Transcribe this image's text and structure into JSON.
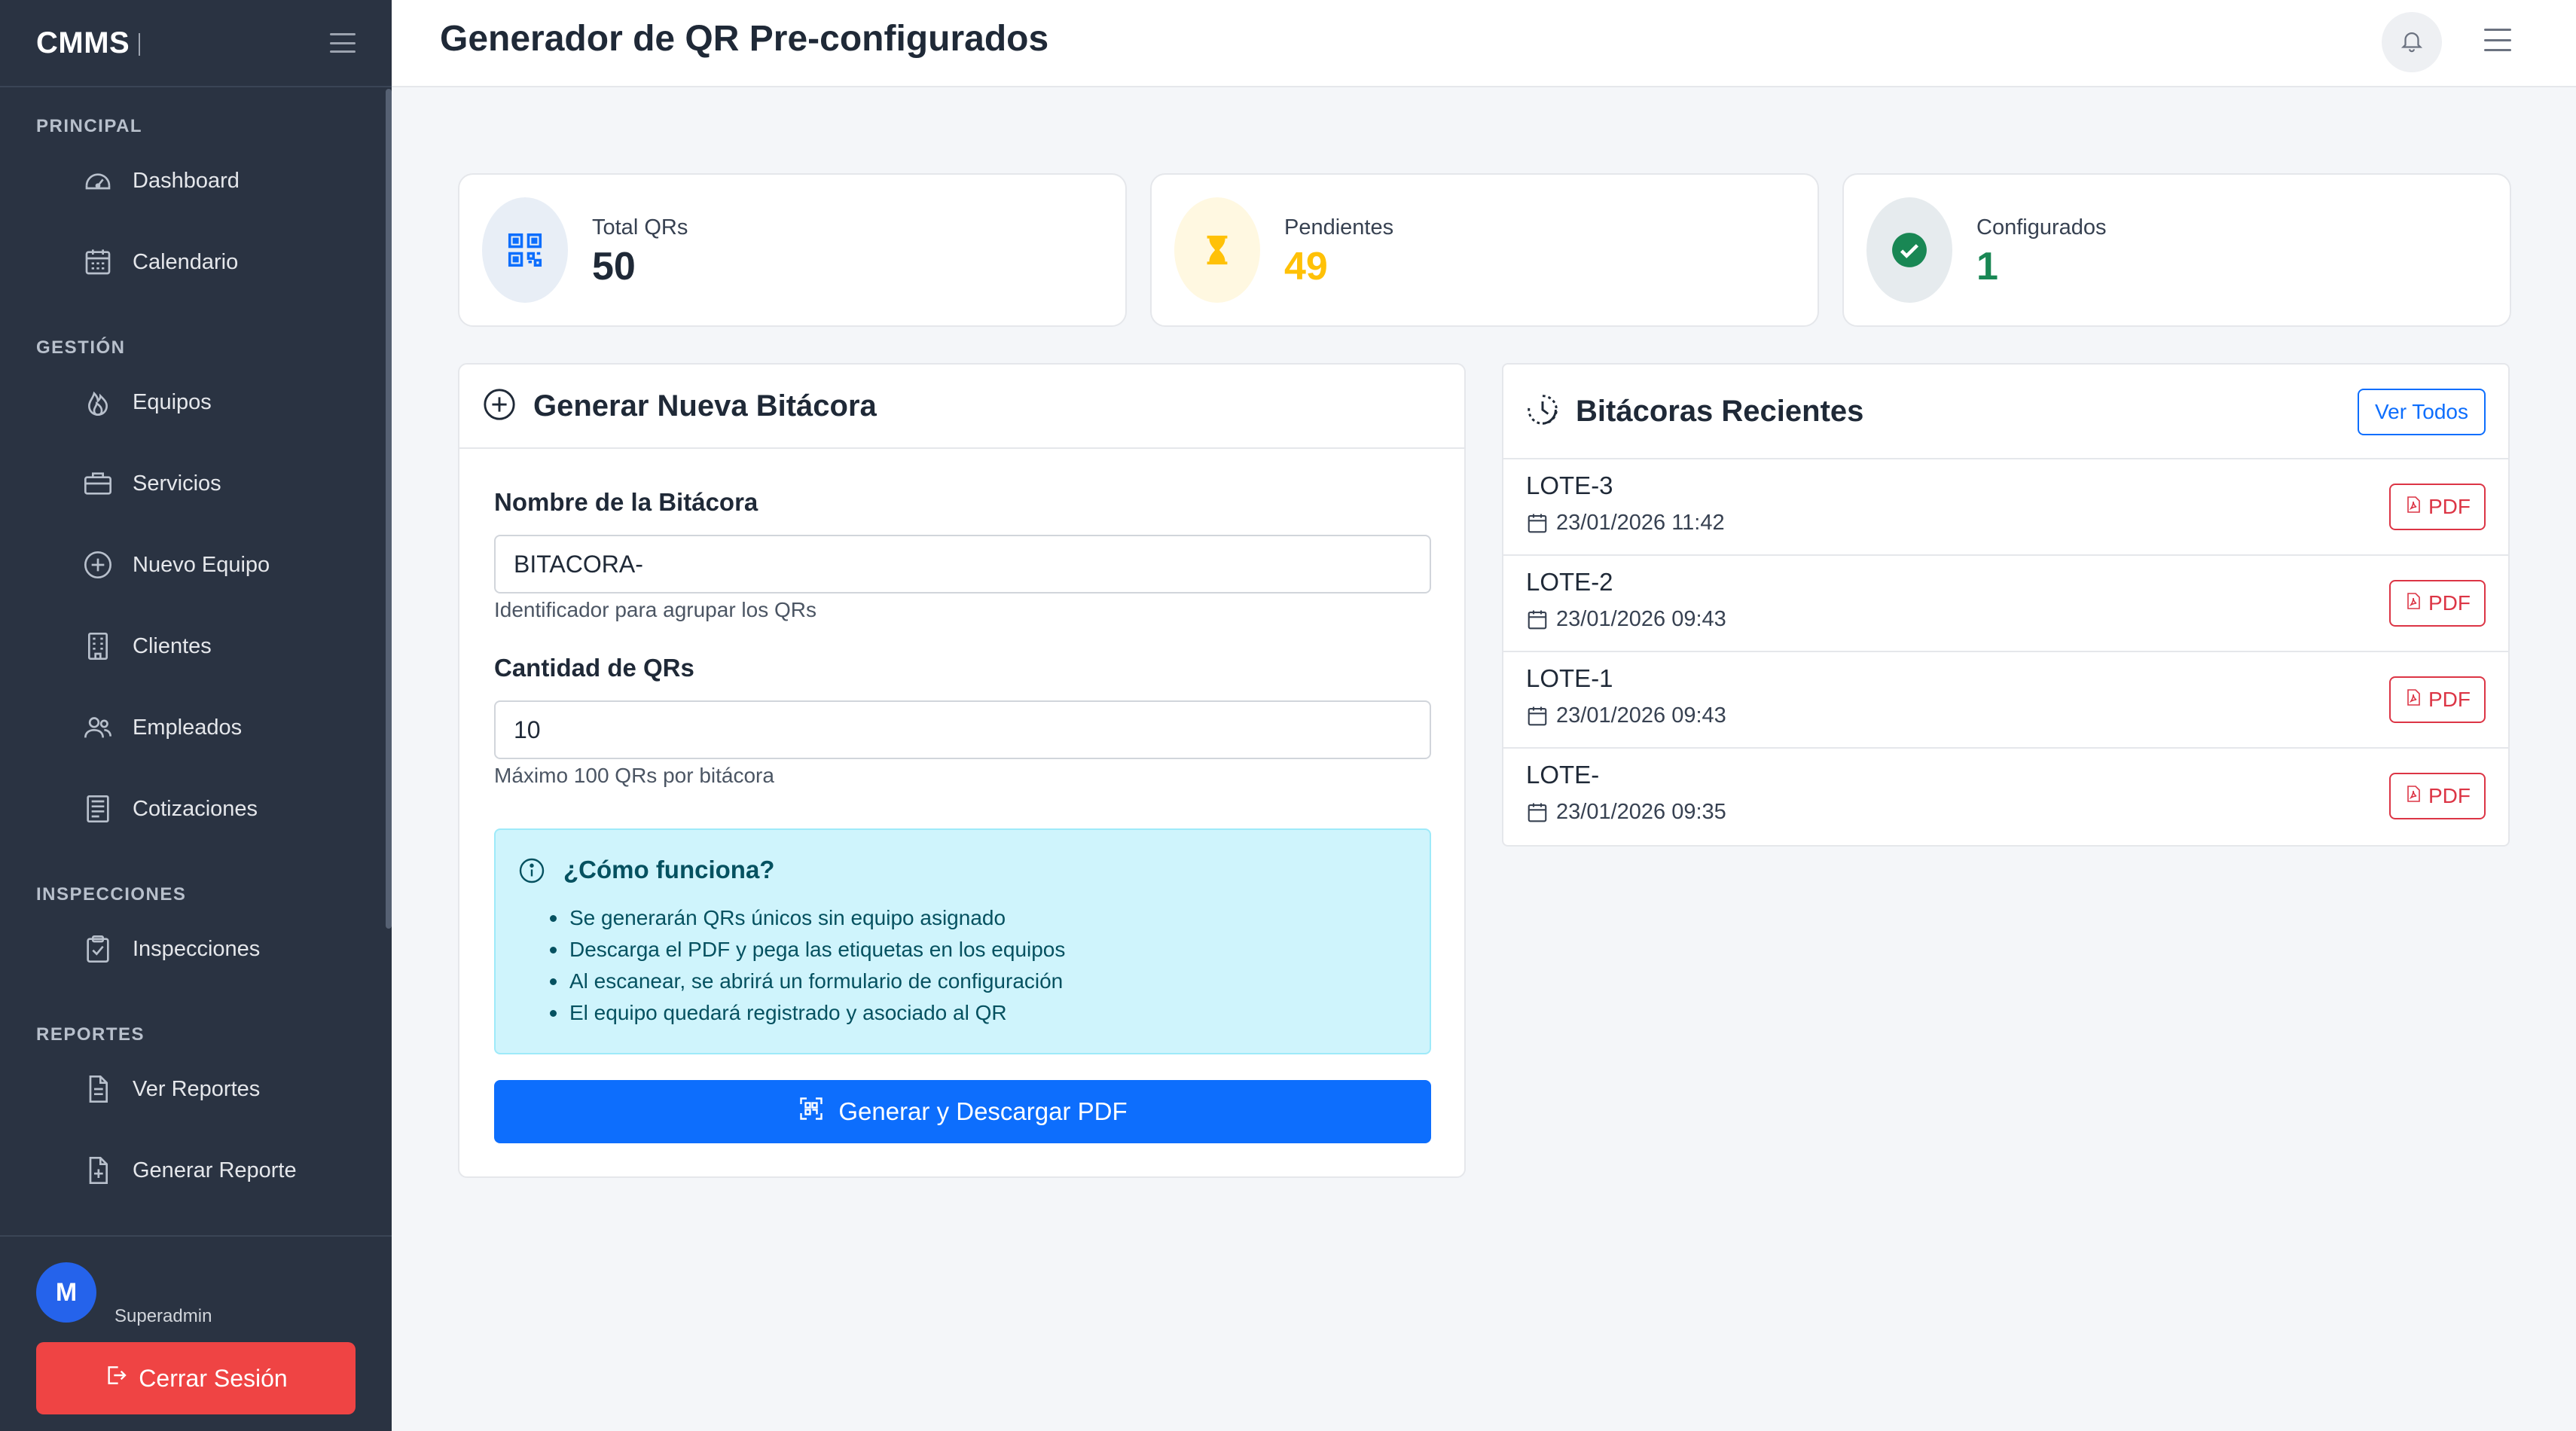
{
  "app": {
    "brand": "CMMS"
  },
  "page": {
    "title": "Generador de QR Pre-configurados"
  },
  "sidebar": {
    "sections": [
      {
        "label": "PRINCIPAL",
        "items": [
          {
            "label": "Dashboard",
            "icon": "gauge-icon"
          },
          {
            "label": "Calendario",
            "icon": "calendar-icon"
          }
        ]
      },
      {
        "label": "GESTIÓN",
        "items": [
          {
            "label": "Equipos",
            "icon": "fire-icon"
          },
          {
            "label": "Servicios",
            "icon": "briefcase-icon"
          },
          {
            "label": "Nuevo Equipo",
            "icon": "plus-circle-icon"
          },
          {
            "label": "Clientes",
            "icon": "building-icon"
          },
          {
            "label": "Empleados",
            "icon": "people-icon"
          },
          {
            "label": "Cotizaciones",
            "icon": "receipt-icon"
          }
        ]
      },
      {
        "label": "INSPECCIONES",
        "items": [
          {
            "label": "Inspecciones",
            "icon": "clipboard-check-icon"
          }
        ]
      },
      {
        "label": "REPORTES",
        "items": [
          {
            "label": "Ver Reportes",
            "icon": "file-text-icon"
          },
          {
            "label": "Generar Reporte",
            "icon": "file-plus-icon"
          }
        ]
      }
    ],
    "user": {
      "initial": "M",
      "role": "Superadmin"
    },
    "logout_label": "Cerrar Sesión"
  },
  "stats": [
    {
      "label": "Total QRs",
      "value": "50",
      "color": "#0d6efd",
      "icon": "qr-code-icon"
    },
    {
      "label": "Pendientes",
      "value": "49",
      "color": "#ffc107",
      "icon": "hourglass-icon"
    },
    {
      "label": "Configurados",
      "value": "1",
      "color": "#198754",
      "icon": "check-circle-icon"
    }
  ],
  "form": {
    "title": "Generar Nueva Bitácora",
    "name_label": "Nombre de la Bitácora",
    "name_value": "BITACORA-",
    "name_help": "Identificador para agrupar los QRs",
    "qty_label": "Cantidad de QRs",
    "qty_value": "10",
    "qty_help": "Máximo 100 QRs por bitácora",
    "info_title": "¿Cómo funciona?",
    "info_items": [
      "Se generarán QRs únicos sin equipo asignado",
      "Descarga el PDF y pega las etiquetas en los equipos",
      "Al escanear, se abrirá un formulario de configuración",
      "El equipo quedará registrado y asociado al QR"
    ],
    "submit_label": "Generar y Descargar PDF"
  },
  "recent": {
    "title": "Bitácoras Recientes",
    "view_all_label": "Ver Todos",
    "pdf_label": "PDF",
    "items": [
      {
        "name": "LOTE-3",
        "date": "23/01/2026 11:42"
      },
      {
        "name": "LOTE-2",
        "date": "23/01/2026 09:43"
      },
      {
        "name": "LOTE-1",
        "date": "23/01/2026 09:43"
      },
      {
        "name": "LOTE-",
        "date": "23/01/2026 09:35"
      }
    ]
  }
}
